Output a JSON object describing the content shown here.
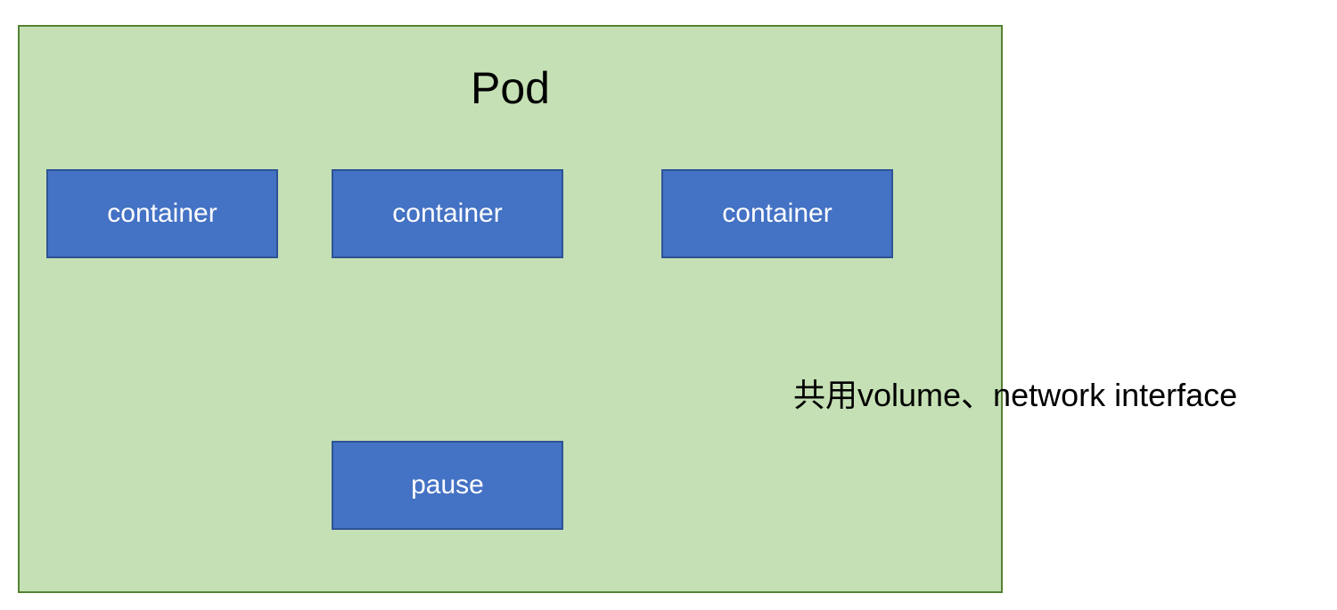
{
  "pod": {
    "title": "Pod",
    "containers": [
      {
        "label": "container"
      },
      {
        "label": "container"
      },
      {
        "label": "container"
      }
    ],
    "pause": {
      "label": "pause"
    }
  },
  "annotation": "共用volume、network interface",
  "colors": {
    "pod_bg": "#c5e0b4",
    "pod_border": "#548235",
    "box_bg": "#4472c4",
    "box_border": "#2e5395"
  }
}
